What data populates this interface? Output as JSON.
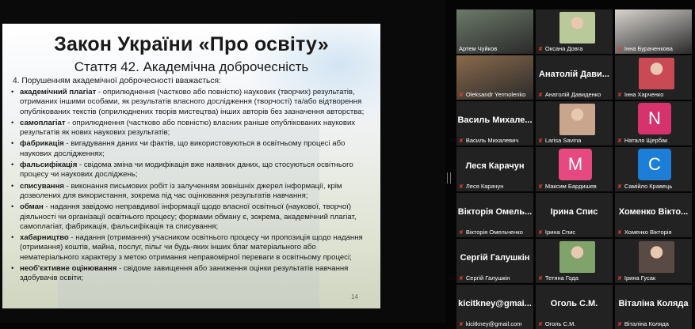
{
  "slide": {
    "title": "Закон України «Про освіту»",
    "subtitle": "Стаття 42. Академічна доброчесність",
    "intro": "4. Порушенням академічної доброчесності вважається:",
    "items": [
      {
        "term": "академічний плагіат",
        "text": " - оприлюднення (частково або повністю) наукових (творчих) результатів, отриманих іншими особами, як результатів власного дослідження (творчості) та/або відтворення опублікованих текстів (оприлюднених творів мистецтва) інших авторів без зазначення авторства;"
      },
      {
        "term": "самоплагіат",
        "text": " - оприлюднення (частково або повністю) власних раніше опублікованих наукових результатів як нових наукових результатів;"
      },
      {
        "term": "фабрикація",
        "text": " - вигадування даних чи фактів, що використовуються в освітньому процесі або наукових дослідженнях;"
      },
      {
        "term": "фальсифікація",
        "text": " - свідома зміна чи модифікація вже наявних даних, що стосуються освітнього процесу чи наукових досліджень;"
      },
      {
        "term": "списування",
        "text": " - виконання письмових робіт із залученням зовнішніх джерел інформації, крім дозволених для використання, зокрема під час оцінювання результатів навчання;"
      },
      {
        "term": "обман",
        "text": " - надання завідомо неправдивої інформації щодо власної освітньої (наукової, творчої) діяльності чи організації освітнього процесу; формами обману є, зокрема, академічний плагіат, самоплагіат, фабрикація, фальсифікація та списування;"
      },
      {
        "term": "хабарництво",
        "text": " - надання (отримання) учасником освітнього процесу чи пропозиція щодо надання (отримання) коштів, майна, послуг, пільг чи будь-яких інших благ матеріального або нематеріального характеру з метою отримання неправомірної переваги в освітньому процесі;"
      },
      {
        "term": "необ'єктивне оцінювання",
        "text": " - свідоме завищення або заниження оцінки результатів навчання здобувачів освіти;"
      }
    ],
    "page_number": "14"
  },
  "participants": [
    {
      "name": "Артем Чуйков",
      "big": "",
      "kind": "video",
      "color": "#6d7a6a",
      "active": true
    },
    {
      "name": "Оксана Довга",
      "big": "",
      "kind": "photo",
      "color": "#b9c99a"
    },
    {
      "name": "Інна Бураченкова",
      "big": "",
      "kind": "video",
      "color": "#d8d4cf"
    },
    {
      "name": "Oleksandr Yermolenko",
      "big": "",
      "kind": "video",
      "color": "#8a6a4c"
    },
    {
      "name": "Анатолій Давиденко",
      "big": "Анатолій Дави...",
      "kind": "name",
      "color": ""
    },
    {
      "name": "Інна Харченко",
      "big": "",
      "kind": "photo",
      "color": "#c94a55"
    },
    {
      "name": "Василь Михалевич",
      "big": "Василь Михале...",
      "kind": "name",
      "color": ""
    },
    {
      "name": "Larisa Savina",
      "big": "",
      "kind": "photo",
      "color": "#c8a58c"
    },
    {
      "name": "Наталя Щербак",
      "big": "N",
      "kind": "letter",
      "color": "#d6336c"
    },
    {
      "name": "Леся Карачун",
      "big": "Леся Карачун",
      "kind": "name",
      "color": ""
    },
    {
      "name": "Максим Бардишев",
      "big": "M",
      "kind": "letter",
      "color": "#e64980"
    },
    {
      "name": "Самійло Кравець",
      "big": "C",
      "kind": "letter",
      "color": "#1c7ed6"
    },
    {
      "name": "Вікторія Омельченко",
      "big": "Вікторія Омель...",
      "kind": "name",
      "color": ""
    },
    {
      "name": "Ірина Спис",
      "big": "Ірина Спис",
      "kind": "name",
      "color": ""
    },
    {
      "name": "Хоменко Вікторія",
      "big": "Хоменко Вікто...",
      "kind": "name",
      "color": ""
    },
    {
      "name": "Сергій Галушкін",
      "big": "Сергій Галушкін",
      "kind": "name",
      "color": ""
    },
    {
      "name": "Тетяна Года",
      "big": "",
      "kind": "photo",
      "color": "#7fa36a"
    },
    {
      "name": "Ірина Гусак",
      "big": "",
      "kind": "photo",
      "color": "#5a4a45"
    },
    {
      "name": "kicitkney@gmail.com",
      "big": "kicitkney@gmai...",
      "kind": "name",
      "color": ""
    },
    {
      "name": "Оголь С.М.",
      "big": "Оголь С.М.",
      "kind": "name",
      "color": ""
    },
    {
      "name": "Віталіна Коляда",
      "big": "Віталіна Коляда",
      "kind": "name",
      "color": ""
    }
  ]
}
